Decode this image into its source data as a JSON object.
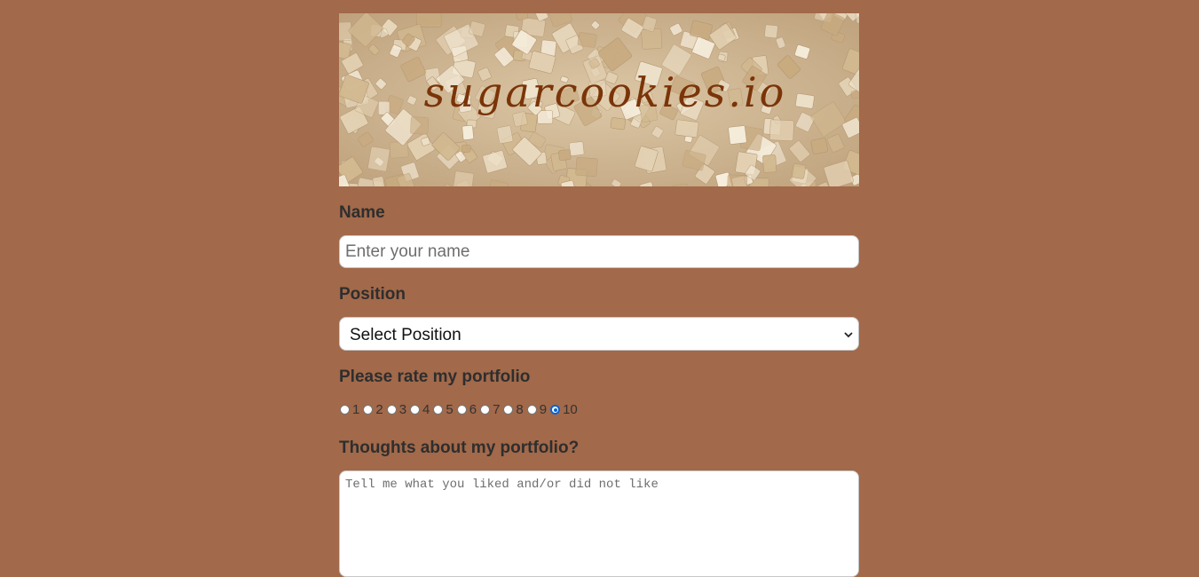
{
  "banner": {
    "brand_text": "sugarcookies.io",
    "brand_color": "#7a3408"
  },
  "colors": {
    "page_background": "#a2694a",
    "radio_checked": "#0b63ce"
  },
  "form": {
    "name_label": "Name",
    "name_placeholder": "Enter your name",
    "position_label": "Position",
    "position_selected": "Select Position",
    "rating_label": "Please rate my portfolio",
    "rating_options": [
      "1",
      "2",
      "3",
      "4",
      "5",
      "6",
      "7",
      "8",
      "9",
      "10"
    ],
    "rating_selected": "10",
    "thoughts_label": "Thoughts about my portfolio?",
    "thoughts_placeholder": "Tell me what you liked and/or did not like"
  }
}
